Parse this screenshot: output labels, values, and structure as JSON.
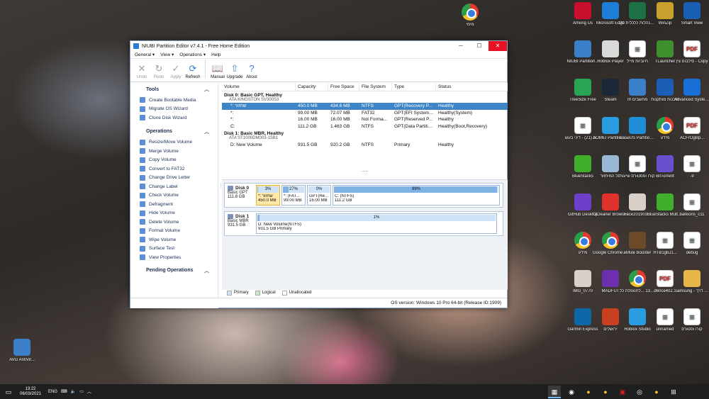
{
  "desktop": {
    "left_icons": [
      {
        "label": "AVG AntiVir...",
        "icon": "avg-icon"
      }
    ],
    "top_icons": [
      {
        "label": "מימי",
        "icon": "chrome-icon"
      }
    ],
    "right_icons": [
      {
        "label": "Among Us",
        "icon": "among-us-icon",
        "color": "#c8102e"
      },
      {
        "label": "Microsoft Edge",
        "icon": "edge-icon",
        "color": "#1e7ed6"
      },
      {
        "label": "התנהלות כלכלית 20",
        "icon": "excel-icon",
        "color": "#1d7044"
      },
      {
        "label": "WinZip",
        "icon": "winzip-icon",
        "color": "#c7a12b"
      },
      {
        "label": "Smart View",
        "icon": "smart-view-icon",
        "color": "#1a5fb4"
      },
      {
        "label": "NIUBI Partition...",
        "icon": "niubi-icon",
        "color": "#3c7fc9"
      },
      {
        "label": "Roblox Player",
        "icon": "roblox-icon",
        "color": "#d9d9d9"
      },
      {
        "label": "חיוביות מייל",
        "icon": "document-icon",
        "color": "#ffffff"
      },
      {
        "label": "TLauncher",
        "icon": "tlauncher-icon",
        "color": "#3f8f2e"
      },
      {
        "label": "סילבוס צין - Copy",
        "icon": "pdf-icon",
        "color": "#ffffff"
      },
      {
        "label": "TreeSize Free",
        "icon": "treesize-icon",
        "color": "#2aa352"
      },
      {
        "label": "Steam",
        "icon": "steam-icon",
        "color": "#1b2838"
      },
      {
        "label": "מחשבים זה",
        "icon": "this-pc-icon",
        "color": "#3c7fc9"
      },
      {
        "label": "תוכנות מותקנות",
        "icon": "programs-icon",
        "color": "#1a5fb4"
      },
      {
        "label": "Advanced SystemCare",
        "icon": "advanced-systemcare-icon",
        "color": "#1a6fd6"
      },
      {
        "label": "מיכתבים (21) - דיני בעש",
        "icon": "document-icon",
        "color": "#ffffff"
      },
      {
        "label": "AOMEI Partition ...",
        "icon": "aomei-icon",
        "color": "#2a9de0"
      },
      {
        "label": "EaseUS Partition ...",
        "icon": "easeus-icon",
        "color": "#1e8fd6"
      },
      {
        "label": "מידע",
        "icon": "chrome-icon",
        "color": "#ffffff"
      },
      {
        "label": "ACFrOgBp...",
        "icon": "pdf-icon",
        "color": "#ffffff"
      },
      {
        "label": "BlueStacks",
        "icon": "bluestacks-icon",
        "color": "#3fae2a"
      },
      {
        "label": "סל המיחזור",
        "icon": "recycle-bin-icon",
        "color": "#9bb7d6"
      },
      {
        "label": "קורו ופסטורס שיעור",
        "icon": "word-icon",
        "color": "#2b579a"
      },
      {
        "label": "BitTorrent",
        "icon": "bittorrent-icon",
        "color": "#6b4fd1"
      },
      {
        "label": "-9",
        "icon": "document-icon",
        "color": "#ffffff"
      },
      {
        "label": "GitHub Desktop",
        "icon": "github-icon",
        "color": "#6e40c9"
      },
      {
        "label": "CCleaner Browser",
        "icon": "ccleaner-icon",
        "color": "#e0322b"
      },
      {
        "label": "Face201903...",
        "icon": "photo-icon",
        "color": "#d8d0c8"
      },
      {
        "label": "BlueStacks Multi-Insta...",
        "icon": "bluestacks-multi-icon",
        "color": "#3fae2a"
      },
      {
        "label": "balloons_c11",
        "icon": "image-icon",
        "color": "#ffffff"
      },
      {
        "label": "מידע",
        "icon": "chrome-icon",
        "color": "#ffffff"
      },
      {
        "label": "Google Chrome (2)",
        "icon": "chrome-icon",
        "color": "#ffffff"
      },
      {
        "label": "eMule Booster",
        "icon": "emule-icon",
        "color": "#6b4a2a"
      },
      {
        "label": "HTB1gbJ1...",
        "icon": "image-icon",
        "color": "#ffffff"
      },
      {
        "label": "debug",
        "icon": "text-file-icon",
        "color": "#ffffff"
      },
      {
        "label": "IMG_0770",
        "icon": "photo-icon",
        "color": "#d8d0c8"
      },
      {
        "label": "MADFUT",
        "icon": "madfut-icon",
        "color": "#6b2fb0"
      },
      {
        "label": "לעניין ערעור 13 ...לחנופלת כל",
        "icon": "chrome-icon",
        "color": "#ffffff"
      },
      {
        "label": "d60ce402...",
        "icon": "pdf-icon",
        "color": "#ffffff"
      },
      {
        "label": "Samsung - קיצור דרך",
        "icon": "folder-icon",
        "color": "#e6b84a"
      },
      {
        "label": "Garmin Express",
        "icon": "garmin-icon",
        "color": "#0e68a8"
      },
      {
        "label": "ירושלים",
        "icon": "app-icon",
        "color": "#c84020"
      },
      {
        "label": "Roblox Studio",
        "icon": "roblox-studio-icon",
        "color": "#2a9de0"
      },
      {
        "label": "unnamed",
        "icon": "image-icon",
        "color": "#ffffff"
      },
      {
        "label": "קורו וסטורס",
        "icon": "document-icon",
        "color": "#ffffff"
      }
    ]
  },
  "window": {
    "title": "NIUBI Partition Editor v7.4.1 - Free Home Edition",
    "min": "─",
    "max": "☐",
    "close": "✕"
  },
  "menu": [
    "General",
    "View",
    "Operations",
    "Help"
  ],
  "toolbar": [
    {
      "label": "Undo",
      "icon": "undo-icon",
      "glyph": "✕",
      "enabled": false
    },
    {
      "label": "Redo",
      "icon": "redo-icon",
      "glyph": "↻",
      "enabled": false
    },
    {
      "label": "Apply",
      "icon": "apply-icon",
      "glyph": "✓",
      "enabled": false
    },
    {
      "label": "Refresh",
      "icon": "refresh-icon",
      "glyph": "⟳",
      "enabled": true
    },
    {
      "label": "Manual",
      "icon": "manual-icon",
      "glyph": "📖",
      "enabled": true
    },
    {
      "label": "Upgrade",
      "icon": "upgrade-icon",
      "glyph": "⇧",
      "enabled": true
    },
    {
      "label": "About",
      "icon": "about-icon",
      "glyph": "?",
      "enabled": true
    }
  ],
  "sidebar": {
    "tools_title": "Tools",
    "tools": [
      "Create Bootable Media",
      "Migrate OS Wizard",
      "Clone Disk Wizard"
    ],
    "operations_title": "Operations",
    "operations": [
      "Resize/Move Volume",
      "Merge Volume",
      "Copy Volume",
      "Convert to FAT32",
      "Change Drive Letter",
      "Change Label",
      "Check Volume",
      "Defragment",
      "Hide Volume",
      "Delete Volume",
      "Format Volume",
      "Wipe Volume",
      "Surface Test",
      "View Properties"
    ],
    "pending_title": "Pending Operations"
  },
  "columns": [
    "Volume",
    "Capacity",
    "Free Space",
    "File System",
    "Type",
    "Status"
  ],
  "disks": [
    {
      "header": "Disk 0: Basic GPT, Healthy",
      "model": "ATA KINGSTON SV300S3",
      "rows": [
        [
          "*: שחזור",
          "450.0 MB",
          "434.6 MB",
          "NTFS",
          "GPT(Recovery P...",
          "Healthy"
        ],
        [
          "*:",
          "99.00 MB",
          "72.07 MB",
          "FAT32",
          "GPT(EFI System ...",
          "Healthy(System)"
        ],
        [
          "*:",
          "16.00 MB",
          "16.00 MB",
          "Not Forma...",
          "GPT(Reserved P...",
          "Healthy"
        ],
        [
          "C:",
          "111.2 GB",
          "1.463 GB",
          "NTFS",
          "GPT(Data Partitio...",
          "Healthy(Boot,Recovery)"
        ]
      ]
    },
    {
      "header": "Disk 1: Basic MBR, Healthy",
      "model": "ATA ST1000DM003-1SB1",
      "rows": [
        [
          "D: New Volume",
          "931.5 GB",
          "920.2 GB",
          "NTFS",
          "Primary",
          "Healthy"
        ]
      ]
    }
  ],
  "more_dots": ".....",
  "map": [
    {
      "name": "Disk 0",
      "kind": "Basic GPT",
      "size": "111.8 GB",
      "parts": [
        {
          "pct": "3%",
          "fill": 0.03,
          "name": "*: שחזור",
          "size": "450.0 MB",
          "selected": true
        },
        {
          "pct": "27%",
          "fill": 0.27,
          "name": "*: (FAT...",
          "size": "99.00 MB",
          "selected": false
        },
        {
          "pct": "0%",
          "fill": 0.0,
          "name": "GPT(Re...",
          "size": "16.00 MB",
          "selected": false
        },
        {
          "pct": "99%",
          "fill": 0.99,
          "name": "C: (NTFS)",
          "size": "111.2 GB",
          "selected": false
        }
      ]
    },
    {
      "name": "Disk 1",
      "kind": "Basic MBR",
      "size": "931.5 GB",
      "parts": [
        {
          "pct": "1%",
          "fill": 0.01,
          "name": "D: New Volume(NTFS)",
          "size": "931.5 GB Primary",
          "selected": false
        }
      ]
    }
  ],
  "legend": [
    {
      "label": "Primary",
      "color": "#cfe3f8"
    },
    {
      "label": "Logical",
      "color": "#c9e7c9"
    },
    {
      "label": "Unallocated",
      "color": "#ffffff"
    }
  ],
  "status": "OS version: Windows 10 Pro  64-bit  (Release ID:1909)",
  "taskbar": {
    "time": "13:22",
    "date": "06/03/2021",
    "lang": "ENG",
    "pinned": [
      "niubi-icon",
      "obs-icon",
      "chrome-icon",
      "chrome-icon",
      "pdf-icon",
      "bittorrent-icon",
      "chrome-icon",
      "windows-icon"
    ]
  },
  "colors": {
    "accent": "#3d85c6",
    "selected_part": "#ffe8a8",
    "close": "#e81123"
  }
}
